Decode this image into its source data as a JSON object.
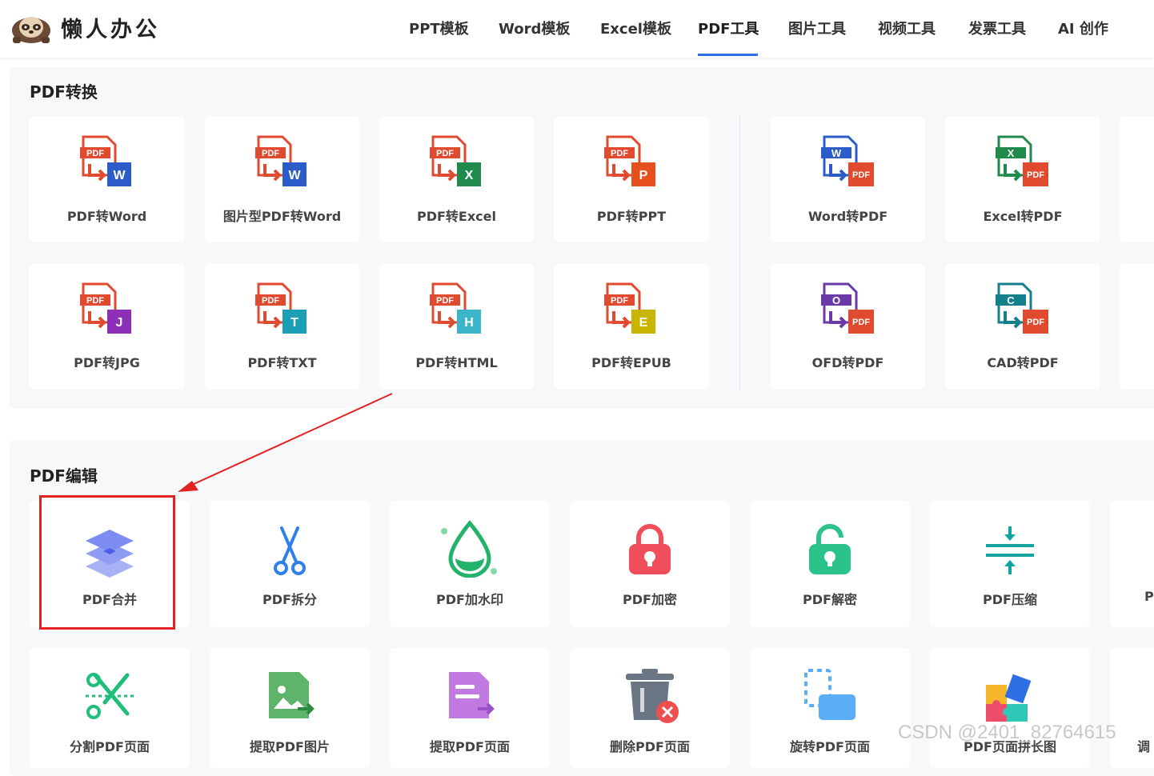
{
  "header": {
    "brand": "懒人办公",
    "nav": [
      "PPT模板",
      "Word模板",
      "Excel模板",
      "PDF工具",
      "图片工具",
      "视频工具",
      "发票工具",
      "AI 创作"
    ],
    "active_nav": "PDF工具"
  },
  "pdf_convert": {
    "title": "PDF转换",
    "items": [
      "PDF转Word",
      "图片型PDF转Word",
      "PDF转Excel",
      "PDF转PPT",
      "Word转PDF",
      "Excel转PDF",
      "PDF转JPG",
      "PDF转TXT",
      "PDF转HTML",
      "PDF转EPUB",
      "OFD转PDF",
      "CAD转PDF"
    ],
    "badges": {
      "pdf": "PDF",
      "word": "W",
      "excel": "X",
      "ppt": "P",
      "jpg": "J",
      "txt": "T",
      "html": "H",
      "epub": "E",
      "ofd": "O",
      "cad": "C"
    }
  },
  "pdf_edit": {
    "title": "PDF编辑",
    "row1": [
      "PDF合并",
      "PDF拆分",
      "PDF加水印",
      "PDF加密",
      "PDF解密",
      "PDF压缩",
      "P"
    ],
    "row2": [
      "分割PDF页面",
      "提取PDF图片",
      "提取PDF页面",
      "删除PDF页面",
      "旋转PDF页面",
      "PDF页面拼长图",
      "调"
    ]
  },
  "watermark": "CSDN @2401_82764615",
  "colors": {
    "pdf_red": "#e04a2f",
    "word_blue": "#2b5cc8",
    "excel_green": "#1f8a4c",
    "ppt_orange": "#e6501e",
    "jpg_purple": "#8e2fb8",
    "txt_teal": "#1a9fb5",
    "html_teal": "#3ab5c9",
    "epub_yellow": "#c9b400",
    "ofd_purple": "#6a3aa8",
    "cad_teal": "#167f8c",
    "accent_blue": "#2f6fe4",
    "highlight_red": "#e52222"
  }
}
